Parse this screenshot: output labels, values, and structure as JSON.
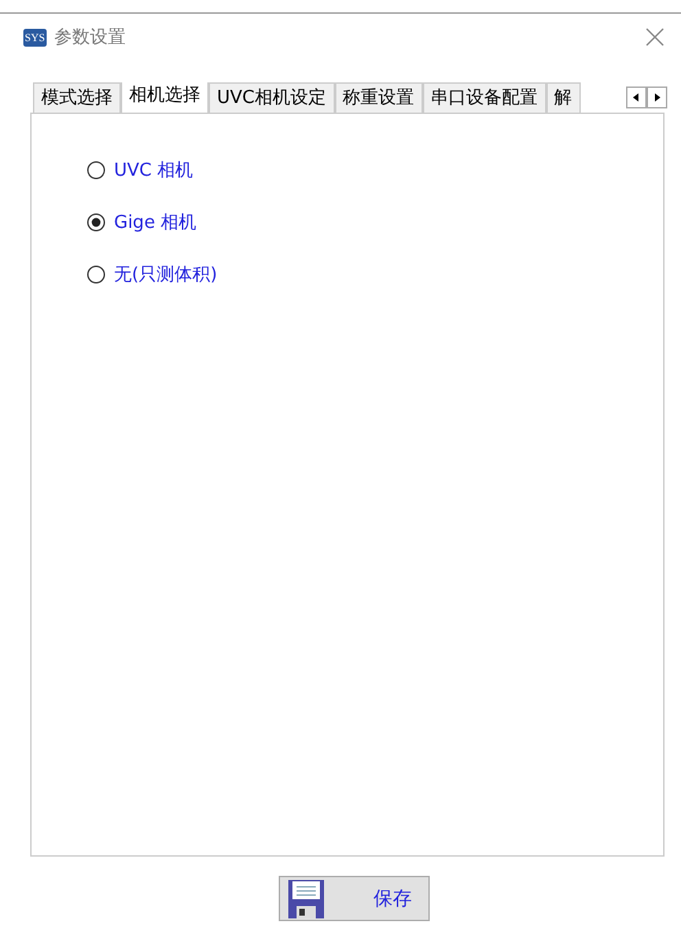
{
  "window": {
    "title": "参数设置",
    "icon_text": "SYS"
  },
  "tabs": [
    {
      "label": "模式选择",
      "selected": false
    },
    {
      "label": "相机选择",
      "selected": true
    },
    {
      "label": "UVC相机设定",
      "selected": false
    },
    {
      "label": "称重设置",
      "selected": false
    },
    {
      "label": "串口设备配置",
      "selected": false
    },
    {
      "label": "解",
      "selected": false
    }
  ],
  "radios": [
    {
      "label": "UVC 相机",
      "selected": false
    },
    {
      "label": "Gige 相机",
      "selected": true
    },
    {
      "label": "无(只测体积)",
      "selected": false
    }
  ],
  "save_button": {
    "label": "保存"
  }
}
